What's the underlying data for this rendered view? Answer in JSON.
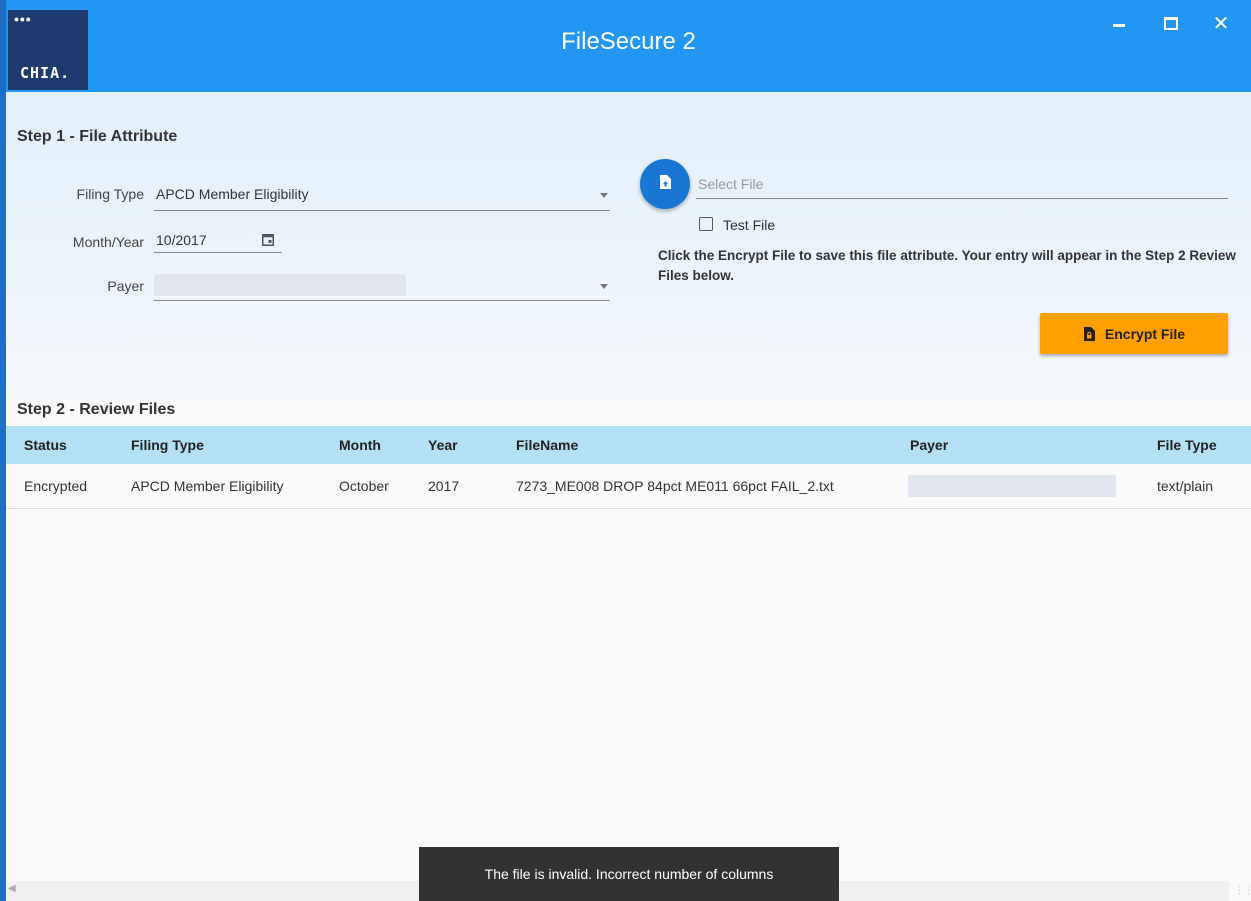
{
  "window": {
    "title": "FileSecure 2",
    "logo_text": "CHIA.",
    "logo_dots": "•••",
    "min_icon": "minimize-icon",
    "max_icon": "maximize-icon",
    "close_icon": "close-icon",
    "close_glyph": "✕"
  },
  "step1": {
    "title": "Step 1 - File Attribute",
    "filing_type_label": "Filing Type",
    "filing_type_value": "APCD Member Eligibility",
    "month_year_label": "Month/Year",
    "month_year_value": "10/2017",
    "payer_label": "Payer",
    "payer_value": "",
    "select_file_placeholder": "Select File",
    "test_file_label": "Test File",
    "test_file_checked": false,
    "hint": "Click the Encrypt File to save this file attribute. Your entry will appear in the Step 2 Review Files below.",
    "encrypt_label": "Encrypt File"
  },
  "step2": {
    "title": "Step 2 - Review Files",
    "columns": [
      "Status",
      "Filing Type",
      "Month",
      "Year",
      "FileName",
      "Payer",
      "File Type"
    ],
    "rows": [
      {
        "status": "Encrypted",
        "filing_type": "APCD Member Eligibility",
        "month": "October",
        "year": "2017",
        "filename": "7273_ME008 DROP 84pct ME011 66pct FAIL_2.txt",
        "payer": "",
        "file_type": "text/plain"
      }
    ]
  },
  "snackbar": {
    "message": "The file is invalid. Incorrect number of columns"
  },
  "colors": {
    "titlebar": "#2196f3",
    "accent_button": "#ffa000",
    "fab": "#1976d2",
    "table_header": "#b3e0f5",
    "snackbar": "#323232"
  }
}
